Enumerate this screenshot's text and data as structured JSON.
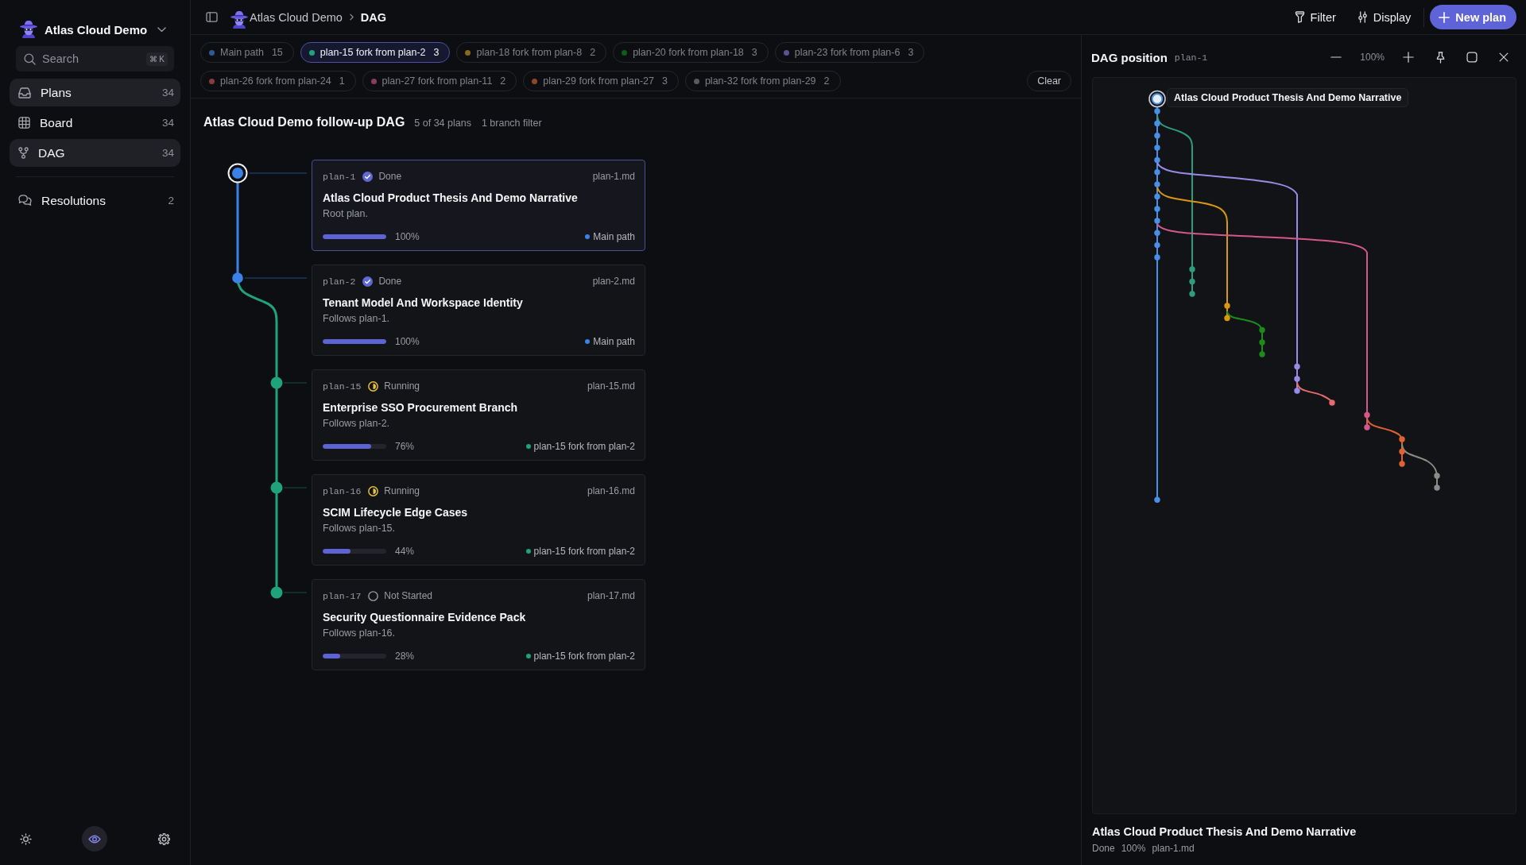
{
  "sidebar": {
    "workspace": {
      "name": "Atlas Cloud Demo"
    },
    "search": {
      "placeholder": "Search",
      "shortcut": "⌘ K"
    },
    "nav": [
      {
        "kind": "plans",
        "label": "Plans",
        "count": "34",
        "selected": true
      },
      {
        "kind": "board",
        "label": "Board",
        "count": "34",
        "selected": false
      },
      {
        "kind": "dag",
        "label": "DAG",
        "count": "34",
        "selected": true
      }
    ],
    "secondary_nav": [
      {
        "kind": "resolutions",
        "label": "Resolutions",
        "count": "2",
        "selected": false
      }
    ],
    "footer_buttons": [
      {
        "kind": "theme",
        "on": false
      },
      {
        "kind": "preview",
        "on": true
      },
      {
        "kind": "settings",
        "on": false
      }
    ]
  },
  "topbar": {
    "breadcrumb": [
      "Atlas Cloud Demo",
      "DAG"
    ],
    "actions": [
      {
        "kind": "filter",
        "label": "Filter"
      },
      {
        "kind": "display",
        "label": "Display"
      }
    ],
    "primary_button": {
      "label": "New plan"
    }
  },
  "branch_filters": {
    "chips": [
      {
        "label": "Main path",
        "count": "15",
        "color": "#2c5a96",
        "selected": false
      },
      {
        "label": "plan-15 fork from plan-2",
        "count": "3",
        "color": "#1fa37a",
        "selected": true
      },
      {
        "label": "plan-18 fork from plan-8",
        "count": "2",
        "color": "#8a6a1a",
        "selected": false
      },
      {
        "label": "plan-20 fork from plan-18",
        "count": "3",
        "color": "#0f5c16",
        "selected": false
      },
      {
        "label": "plan-23 fork from plan-6",
        "count": "3",
        "color": "#5b5296",
        "selected": false
      },
      {
        "label": "plan-26 fork from plan-24",
        "count": "1",
        "color": "#8a3c3c",
        "selected": false
      },
      {
        "label": "plan-27 fork from plan-11",
        "count": "2",
        "color": "#8a3c5e",
        "selected": false
      },
      {
        "label": "plan-29 fork from plan-27",
        "count": "3",
        "color": "#8a4a26",
        "selected": false
      },
      {
        "label": "plan-32 fork from plan-29",
        "count": "2",
        "color": "#5a5a5a",
        "selected": false
      }
    ],
    "clear_button": "Clear"
  },
  "dag_list": {
    "title": "Atlas Cloud Demo follow-up DAG",
    "plan_count": "5 of 34 plans",
    "filter_count": "1 branch filter",
    "cards": [
      {
        "id": "plan-1",
        "status": {
          "label": "Done",
          "kind": "done"
        },
        "file": "plan-1.md",
        "title": "Atlas Cloud Product Thesis And Demo Narrative",
        "description": "Root plan.",
        "level": 1,
        "progress": "100%",
        "branch": "Main path",
        "color": "#3b82e8",
        "selected": true
      },
      {
        "id": "plan-2",
        "status": {
          "label": "Done",
          "kind": "done"
        },
        "file": "plan-2.md",
        "title": "Tenant Model And Workspace Identity",
        "description": "Follows plan-1.",
        "level": 1,
        "progress": "100%",
        "branch": "Main path",
        "color": "#3b82e8",
        "selected": false
      },
      {
        "id": "plan-15",
        "status": {
          "label": "Running",
          "kind": "running"
        },
        "file": "plan-15.md",
        "title": "Enterprise SSO Procurement Branch",
        "description": "Follows plan-2.",
        "level": 0.76,
        "progress": "76%",
        "branch": "plan-15 fork from plan-2",
        "color": "#1fa37a",
        "selected": false
      },
      {
        "id": "plan-16",
        "status": {
          "label": "Running",
          "kind": "running"
        },
        "file": "plan-16.md",
        "title": "SCIM Lifecycle Edge Cases",
        "description": "Follows plan-15.",
        "level": 0.44,
        "progress": "44%",
        "branch": "plan-15 fork from plan-2",
        "color": "#1fa37a",
        "selected": false
      },
      {
        "id": "plan-17",
        "status": {
          "label": "Not Started",
          "kind": "not_started"
        },
        "file": "plan-17.md",
        "title": "Security Questionnaire Evidence Pack",
        "description": "Follows plan-16.",
        "level": 0.28,
        "progress": "28%",
        "branch": "plan-15 fork from plan-2",
        "color": "#1fa37a",
        "selected": false
      }
    ]
  },
  "dag_panel": {
    "title": "DAG position",
    "plan_id": "plan-1",
    "zoom": "100%",
    "canvas_label": "Atlas Cloud Product Thesis And Demo Narrative",
    "footer": {
      "title": "Atlas Cloud Product Thesis And Demo Narrative",
      "status": "Done",
      "progress": "100%",
      "file": "plan-1.md"
    }
  }
}
